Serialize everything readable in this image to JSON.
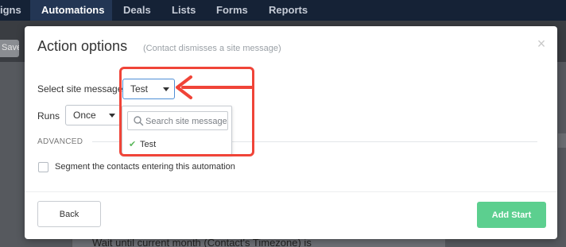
{
  "nav": {
    "items": [
      "igns",
      "Automations",
      "Deals",
      "Lists",
      "Forms",
      "Reports"
    ],
    "active": "Automations"
  },
  "toolbar": {
    "save_label": "Save"
  },
  "background": {
    "card_text": "Wait until current month (Contact's Timezone) is"
  },
  "modal": {
    "title": "Action options",
    "subtitle": "(Contact dismisses a site message)",
    "close_icon": "×",
    "select_message": {
      "label": "Select site message",
      "value": "Test"
    },
    "runs": {
      "label": "Runs",
      "value": "Once"
    },
    "dropdown": {
      "search_placeholder": "Search site message",
      "options": [
        {
          "label": "Test",
          "selected": true
        }
      ]
    },
    "advanced_label": "ADVANCED",
    "segment_checkbox": {
      "label": "Segment the contacts entering this automation",
      "checked": false
    },
    "buttons": {
      "back": "Back",
      "add_start": "Add Start"
    }
  },
  "colors": {
    "nav_bg": "#152236",
    "primary_green": "#5ccf8f",
    "annotation_red": "#f04438",
    "check_green": "#5cb85c"
  }
}
